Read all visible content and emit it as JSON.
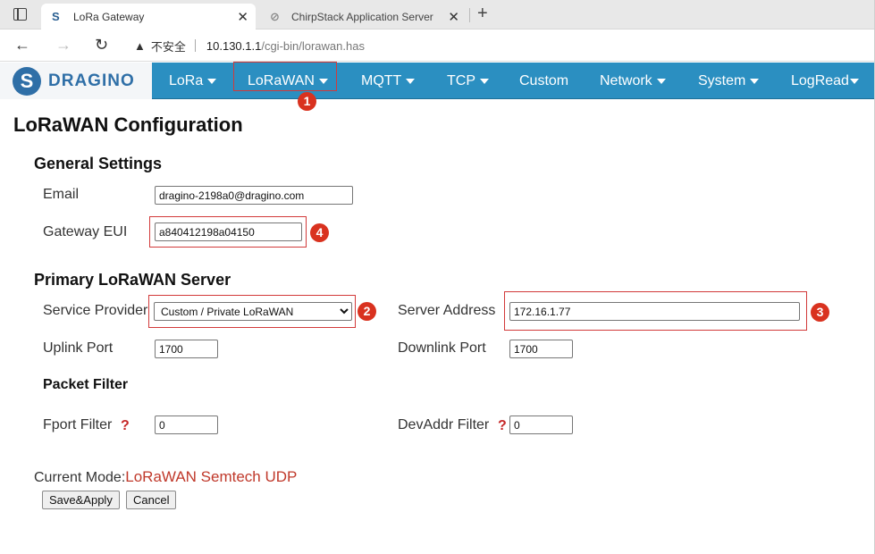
{
  "browser": {
    "tabs": [
      {
        "title": "LoRa Gateway",
        "icon": "dragino-favicon",
        "active": true
      },
      {
        "title": "ChirpStack Application Server",
        "icon": "chirpstack-favicon",
        "active": false
      }
    ],
    "close_glyph": "✕",
    "newtab_glyph": "+",
    "address": {
      "security_label": "不安全",
      "host": "10.130.1.1",
      "path": "/cgi-bin/lorawan.has"
    }
  },
  "app": {
    "logo_text": "DRAGINO",
    "menu": [
      {
        "label": "LoRa",
        "dropdown": true
      },
      {
        "label": "LoRaWAN",
        "dropdown": true
      },
      {
        "label": "MQTT",
        "dropdown": true
      },
      {
        "label": "TCP",
        "dropdown": true
      },
      {
        "label": "Custom",
        "dropdown": false
      },
      {
        "label": "Network",
        "dropdown": true
      },
      {
        "label": "System",
        "dropdown": true
      },
      {
        "label": "LogRead",
        "dropdown": true
      }
    ],
    "colors": {
      "nav_bg": "#2b8fc1",
      "annotation": "#d9321f",
      "mode_value": "#c0392b"
    }
  },
  "page": {
    "title": "LoRaWAN Configuration",
    "general": {
      "heading": "General Settings",
      "email_label": "Email",
      "email_value": "dragino-2198a0@dragino.com",
      "eui_label": "Gateway EUI",
      "eui_value": "a840412198a04150"
    },
    "server": {
      "heading": "Primary LoRaWAN Server",
      "provider_label": "Service Provider",
      "provider_value": "Custom / Private LoRaWAN",
      "address_label": "Server Address",
      "address_value": "172.16.1.77",
      "uplink_label": "Uplink Port",
      "uplink_value": "1700",
      "downlink_label": "Downlink Port",
      "downlink_value": "1700"
    },
    "filter": {
      "heading": "Packet Filter",
      "fport_label": "Fport Filter",
      "fport_value": "0",
      "devaddr_label": "DevAddr Filter",
      "devaddr_value": "0",
      "help_glyph": "?"
    },
    "mode": {
      "label": "Current Mode:",
      "value": "LoRaWAN Semtech UDP"
    },
    "buttons": {
      "save": "Save&Apply",
      "cancel": "Cancel"
    }
  },
  "annotations": [
    "1",
    "2",
    "3",
    "4"
  ]
}
